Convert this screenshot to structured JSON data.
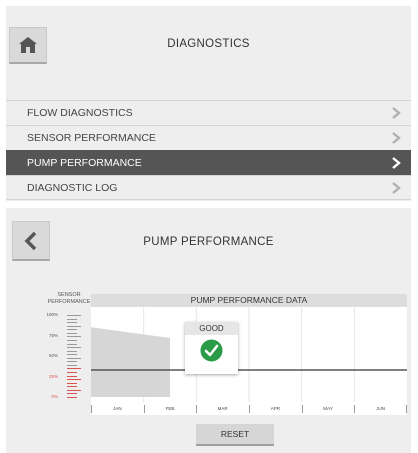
{
  "diagnostics": {
    "title": "DIAGNOSTICS",
    "menu": [
      {
        "label": "FLOW DIAGNOSTICS",
        "active": false
      },
      {
        "label": "SENSOR PERFORMANCE",
        "active": false
      },
      {
        "label": "PUMP PERFORMANCE",
        "active": true
      },
      {
        "label": "DIAGNOSTIC LOG",
        "active": false
      }
    ]
  },
  "pump": {
    "title": "PUMP PERFORMANCE",
    "gauge_title": "SENSOR PERFORMANCE",
    "chart_title": "PUMP PERFORMANCE DATA",
    "status": "GOOD",
    "reset_label": "RESET"
  },
  "colors": {
    "header_bar": "#555555",
    "good_green": "#2a9b47",
    "warning_red": "#d9534f",
    "panel_bg": "#eeeeee"
  },
  "icons": {
    "home": "home-icon",
    "back": "back-arrow-icon",
    "chevron": "chevron-right-icon",
    "check": "check-icon"
  },
  "chart_data": {
    "type": "area",
    "title": "PUMP PERFORMANCE DATA",
    "ylabel": "SENSOR PERFORMANCE",
    "y_ticks": [
      "100%",
      "75%",
      "50%",
      "25%",
      "0%"
    ],
    "ylim": [
      0,
      100
    ],
    "categories": [
      "JAN",
      "FEB",
      "MAR",
      "APR",
      "MAY",
      "JUN"
    ],
    "threshold": 33,
    "series": [
      {
        "x": [
          0,
          1.5
        ],
        "y": [
          85,
          72
        ]
      }
    ],
    "grid": true
  }
}
